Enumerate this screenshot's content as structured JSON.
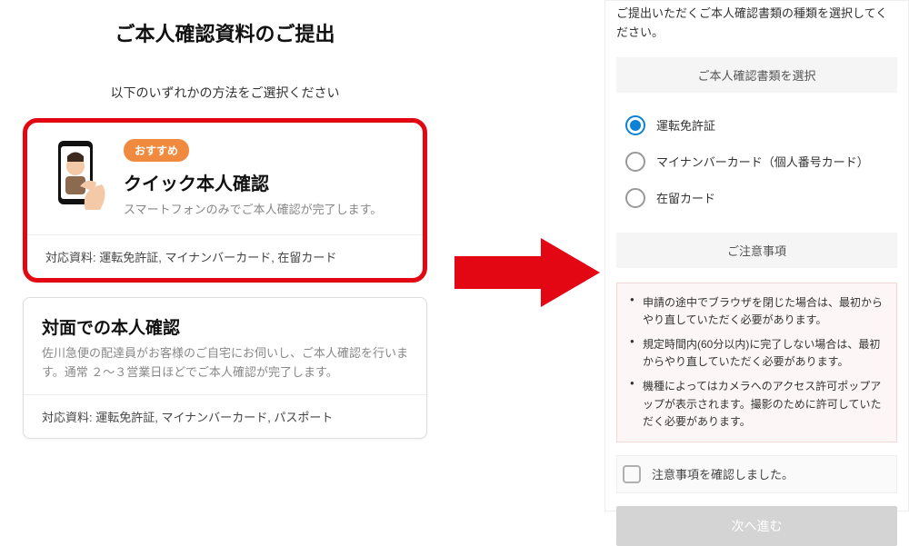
{
  "left": {
    "title": "ご本人確認資料のご提出",
    "subtitle": "以下のいずれかの方法をご選択ください",
    "quick": {
      "badge": "おすすめ",
      "title": "クイック本人確認",
      "desc": "スマートフォンのみでご本人確認が完了します。",
      "supported": "対応資料: 運転免許証, マイナンバーカード, 在留カード"
    },
    "inperson": {
      "title": "対面での本人確認",
      "desc": "佐川急便の配達員がお客様のご自宅にお伺いし、ご本人確認を行います。通常 ２〜３営業日ほどでご本人確認が完了します。",
      "supported": "対応資料: 運転免許証, マイナンバーカード, パスポート"
    }
  },
  "right": {
    "instruction": "ご提出いただくご本人確認書類の種類を選択してください。",
    "selectHeader": "ご本人確認書類を選択",
    "options": [
      {
        "label": "運転免許証",
        "selected": true
      },
      {
        "label": "マイナンバーカード（個人番号カード）",
        "selected": false
      },
      {
        "label": "在留カード",
        "selected": false
      }
    ],
    "noticeHeader": "ご注意事項",
    "notices": [
      "申請の途中でブラウザを閉じた場合は、最初からやり直していただく必要があります。",
      "規定時間内(60分以内)に完了しない場合は、最初からやり直していただく必要があります。",
      "機種によってはカメラへのアクセス許可ポップアップが表示されます。撮影のために許可していただく必要があります。"
    ],
    "confirm": "注意事項を確認しました。",
    "nextButton": "次へ進む"
  },
  "colors": {
    "highlight": "#e30613",
    "badge": "#f08a3e",
    "radioSelected": "#0b81d8"
  }
}
